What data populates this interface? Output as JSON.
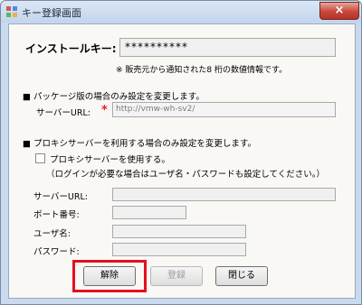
{
  "window": {
    "title": "キー登録画面",
    "close_symbol": "×"
  },
  "install_key": {
    "label": "インストールキー:",
    "value": "**********",
    "note": "※ 販売元から通知された8 桁の数値情報です。"
  },
  "package_section": {
    "heading": "■ パッケージ版の場合のみ設定を変更します。",
    "server_url_label": "サーバーURL:",
    "required_mark": "*",
    "server_url_value": "http://vmw-wh-sv2/"
  },
  "proxy_section": {
    "heading": "■ プロキシサーバーを利用する場合のみ設定を変更します。",
    "use_proxy_label": "プロキシサーバーを使用する。",
    "use_proxy_checked": false,
    "note": "（ログインが必要な場合はユーザ名・パスワードも設定してください。）",
    "server_url_label": "サーバーURL:",
    "server_url_value": "",
    "port_label": "ポート番号:",
    "port_value": "",
    "username_label": "ユーザ名:",
    "username_value": "",
    "password_label": "パスワード:",
    "password_value": ""
  },
  "buttons": {
    "cancel_label": "解除",
    "register_label": "登録",
    "close_label": "閉じる"
  },
  "colors": {
    "highlight": "#e3101f",
    "required_mark": "#e0202a"
  }
}
